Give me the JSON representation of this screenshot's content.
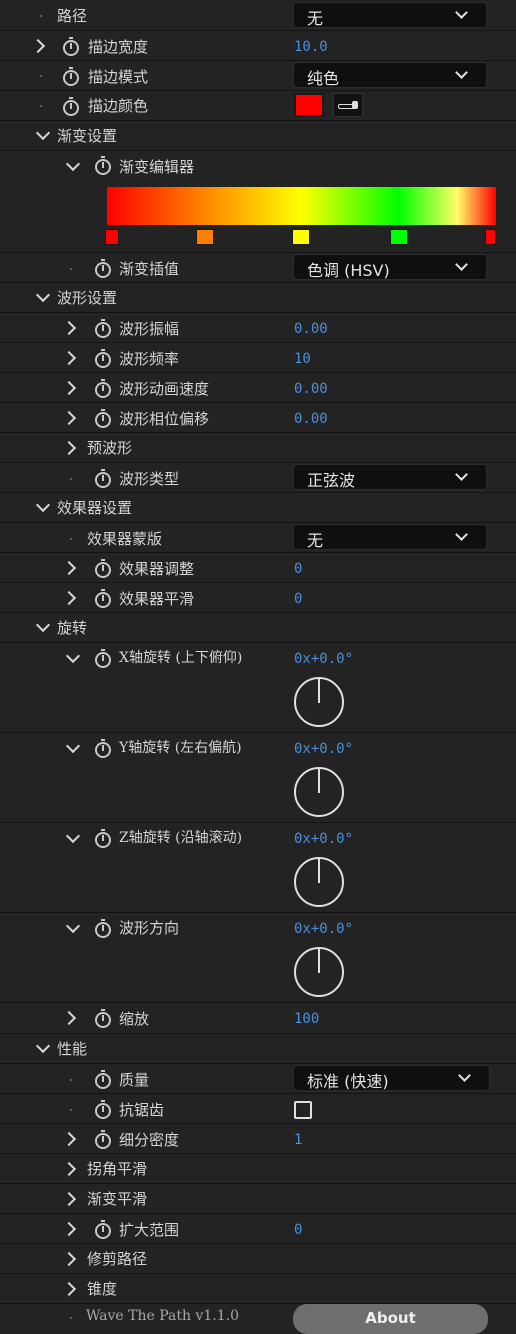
{
  "rows": {
    "path": {
      "label": "路径",
      "dropdown": "无"
    },
    "stroke_width": {
      "label": "描边宽度",
      "value": "10.0"
    },
    "stroke_mode": {
      "label": "描边模式",
      "dropdown": "纯色"
    },
    "stroke_color": {
      "label": "描边颜色",
      "color": "#ff0000"
    },
    "gradient_settings": {
      "label": "渐变设置"
    },
    "gradient_editor": {
      "label": "渐变编辑器",
      "stops": [
        "#ff0000",
        "#ff8000",
        "#ffff00",
        "#00ff00",
        "#ff0000"
      ]
    },
    "gradient_interp": {
      "label": "渐变插值",
      "dropdown": "色调 (HSV)"
    },
    "wave_settings": {
      "label": "波形设置"
    },
    "wave_amp": {
      "label": "波形振幅",
      "value": "0.00"
    },
    "wave_freq": {
      "label": "波形频率",
      "value": "10"
    },
    "wave_speed": {
      "label": "波形动画速度",
      "value": "0.00"
    },
    "wave_phase": {
      "label": "波形相位偏移",
      "value": "0.00"
    },
    "pre_wave": {
      "label": "预波形"
    },
    "wave_type": {
      "label": "波形类型",
      "dropdown": "正弦波"
    },
    "effector_settings": {
      "label": "效果器设置"
    },
    "effector_mask": {
      "label": "效果器蒙版",
      "dropdown": "无"
    },
    "effector_adjust": {
      "label": "效果器调整",
      "value": "0"
    },
    "effector_smooth": {
      "label": "效果器平滑",
      "value": "0"
    },
    "rotation": {
      "label": "旋转"
    },
    "rot_x": {
      "label": "X轴旋转 (上下俯仰)",
      "value": "0x+0.0°"
    },
    "rot_y": {
      "label": "Y轴旋转 (左右偏航)",
      "value": "0x+0.0°"
    },
    "rot_z": {
      "label": "Z轴旋转 (沿轴滚动)",
      "value": "0x+0.0°"
    },
    "wave_dir": {
      "label": "波形方向",
      "value": "0x+0.0°"
    },
    "scale": {
      "label": "缩放",
      "value": "100"
    },
    "performance": {
      "label": "性能"
    },
    "quality": {
      "label": "质量",
      "dropdown": "标准 (快速)"
    },
    "antialias": {
      "label": "抗锯齿",
      "checked": false
    },
    "subdiv": {
      "label": "细分密度",
      "value": "1"
    },
    "corner_smooth": {
      "label": "拐角平滑"
    },
    "gradient_smooth": {
      "label": "渐变平滑"
    },
    "expand_range": {
      "label": "扩大范围",
      "value": "0"
    },
    "trim_path": {
      "label": "修剪路径"
    },
    "taper": {
      "label": "锥度"
    }
  },
  "footer": {
    "version": "Wave The Path v1.1.0",
    "about_label": "About"
  }
}
